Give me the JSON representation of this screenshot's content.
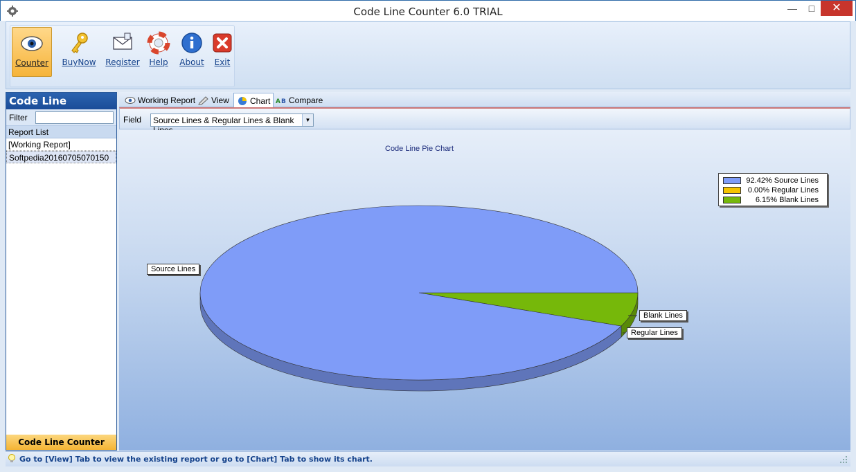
{
  "window": {
    "title": "Code Line Counter 6.0 TRIAL"
  },
  "toolbar": {
    "buttons": [
      {
        "label": "Counter",
        "icon": "eye-icon",
        "active": true
      },
      {
        "label": "BuyNow",
        "icon": "key-icon"
      },
      {
        "label": "Register",
        "icon": "envelope-icon"
      },
      {
        "label": "Help",
        "icon": "lifebuoy-icon"
      },
      {
        "label": "About",
        "icon": "info-icon"
      },
      {
        "label": "Exit",
        "icon": "close-icon"
      }
    ]
  },
  "sidebar": {
    "title": "Code Line Counter",
    "filter_label": "Filter",
    "filter_value": "",
    "list_header": "Report List",
    "items": [
      "[Working Report]",
      "Softpedia20160705070150"
    ],
    "footer": "Code Line Counter"
  },
  "tabs": [
    {
      "label": "Working Report",
      "icon": "eye-icon"
    },
    {
      "label": "View",
      "icon": "pen-icon"
    },
    {
      "label": "Chart",
      "icon": "pie-chart-icon",
      "active": true
    },
    {
      "label": "Compare",
      "icon": "compare-icon"
    }
  ],
  "field": {
    "label": "Field",
    "selected": "Source Lines & Regular Lines & Blank Lines"
  },
  "chart_data": {
    "type": "pie",
    "title": "Code Line Pie Chart",
    "slices": [
      {
        "label": "Source Lines",
        "percent": 92.42,
        "color": "#7f9cf8"
      },
      {
        "label": "Regular Lines",
        "percent": 0.0,
        "color": "#f5c400"
      },
      {
        "label": "Blank Lines",
        "percent": 6.15,
        "color": "#76b80a"
      }
    ],
    "legend": [
      {
        "text": "92.42% Source Lines",
        "color": "#7f9cf8"
      },
      {
        "text": "0.00% Regular Lines",
        "color": "#f5c400"
      },
      {
        "text": "6.15% Blank Lines",
        "color": "#76b80a"
      }
    ],
    "legend_position": "top-right",
    "style": "3d"
  },
  "status": {
    "text": "Go to [View] Tab to view the existing report or go to [Chart] Tab to show its chart."
  },
  "colors": {
    "accent": "#f6b43a",
    "header_blue": "#1a4c98",
    "link": "#15428b"
  }
}
